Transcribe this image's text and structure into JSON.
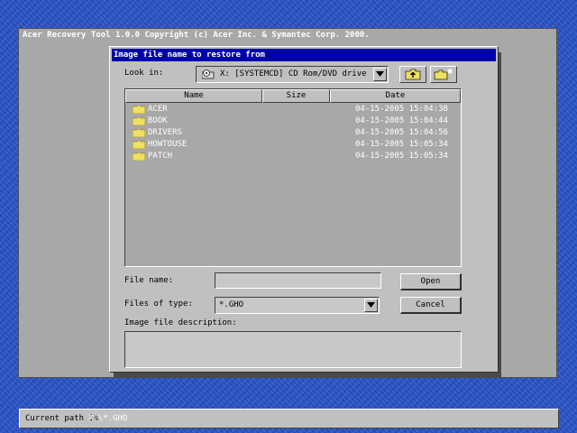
{
  "main_window": {
    "title": "Acer Recovery Tool 1.0.0  Copyright (c) Acer Inc. & Symantec Corp. 2000."
  },
  "dialog": {
    "title": "Image file name to restore from",
    "look_in_label": "Look in:",
    "look_in_value": "X: [SYSTEMCD] CD Rom/DVD drive",
    "columns": {
      "name": "Name",
      "size": "Size",
      "date": "Date"
    },
    "files": [
      {
        "name": "ACER",
        "size": "",
        "date": "04-15-2005 15:04:38"
      },
      {
        "name": "BOOK",
        "size": "",
        "date": "04-15-2005 15:04:44"
      },
      {
        "name": "DRIVERS",
        "size": "",
        "date": "04-15-2005 15:04:56"
      },
      {
        "name": "HOWTOUSE",
        "size": "",
        "date": "04-15-2005 15:05:34"
      },
      {
        "name": "PATCH",
        "size": "",
        "date": "04-15-2005 15:05:34"
      }
    ],
    "file_name_label": "File name:",
    "file_name_value": "",
    "files_of_type_label": "Files of type:",
    "files_of_type_value": "*.GHO",
    "open_button": "Open",
    "cancel_button": "Cancel",
    "description_label": "Image file description:",
    "description_value": ""
  },
  "status_bar": {
    "label": "Current path is",
    "path": "X:\\*.GHO"
  },
  "icons": {
    "drive": "cd-drive-icon",
    "up_folder": "up-one-level-icon",
    "new_folder": "new-folder-icon",
    "folder": "folder-icon",
    "dropdown": "dropdown-arrow-icon"
  },
  "colors": {
    "desktop": "#2a52c8",
    "dialog_title_bar": "#0000a8",
    "folder": "#f0e060"
  }
}
